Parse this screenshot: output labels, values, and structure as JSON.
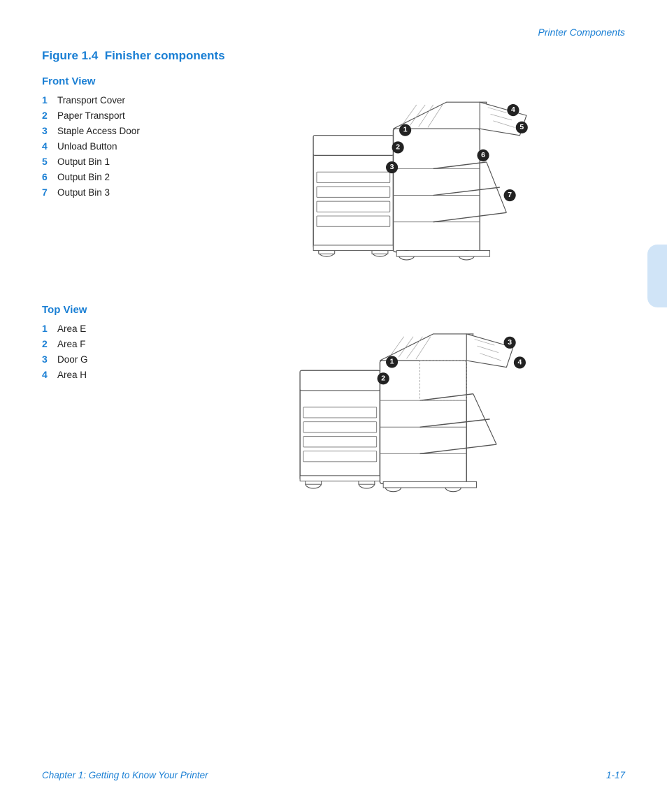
{
  "header": {
    "title": "Printer Components"
  },
  "figure": {
    "label": "Figure 1.4",
    "title": "Finisher components"
  },
  "front_view": {
    "title": "Front View",
    "items": [
      {
        "num": "1",
        "label": "Transport Cover"
      },
      {
        "num": "2",
        "label": "Paper Transport"
      },
      {
        "num": "3",
        "label": "Staple Access Door"
      },
      {
        "num": "4",
        "label": "Unload Button"
      },
      {
        "num": "5",
        "label": "Output Bin 1"
      },
      {
        "num": "6",
        "label": "Output Bin 2"
      },
      {
        "num": "7",
        "label": "Output Bin 3"
      }
    ]
  },
  "top_view": {
    "title": "Top View",
    "items": [
      {
        "num": "1",
        "label": "Area E"
      },
      {
        "num": "2",
        "label": "Area F"
      },
      {
        "num": "3",
        "label": "Door G"
      },
      {
        "num": "4",
        "label": "Area H"
      }
    ]
  },
  "footer": {
    "chapter": "Chapter 1: Getting to Know Your Printer",
    "page": "1-17"
  }
}
